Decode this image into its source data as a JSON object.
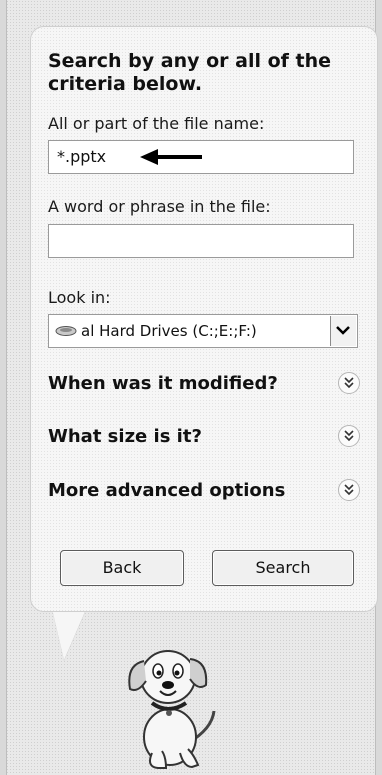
{
  "search": {
    "heading": "Search by any or all of the criteria below.",
    "filename_label": "All or part of the file name:",
    "filename_value": "*.pptx",
    "phrase_label": "A word or phrase in the file:",
    "phrase_value": "",
    "lookin_label": "Look in:",
    "lookin_value": "al Hard Drives (C:;E:;F:)"
  },
  "sections": [
    {
      "label": "When was it modified?",
      "icon": "chevron-double-down-icon"
    },
    {
      "label": "What size is it?",
      "icon": "chevron-double-down-icon"
    },
    {
      "label": "More advanced options",
      "icon": "chevron-double-down-icon"
    }
  ],
  "buttons": {
    "back": "Back",
    "search": "Search"
  },
  "assistant": {
    "character": "search-companion-dog"
  },
  "colors": {
    "annotation_arrow": "#000000",
    "panel_background": "#f6f6f6",
    "pane_background": "#e9e9e9"
  }
}
